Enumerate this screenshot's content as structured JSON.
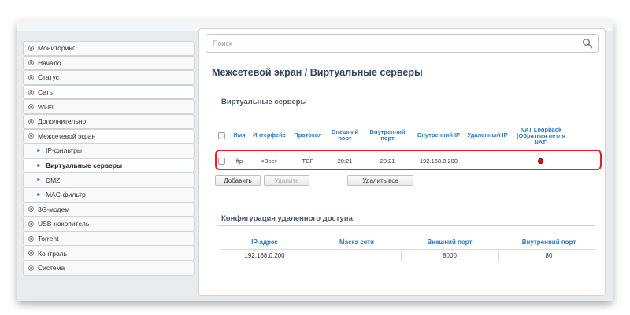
{
  "search": {
    "placeholder": "Поиск"
  },
  "sidebar": {
    "items": [
      {
        "label": "Мониторинг"
      },
      {
        "label": "Начало"
      },
      {
        "label": "Статус"
      },
      {
        "label": "Сеть"
      },
      {
        "label": "Wi-Fi"
      },
      {
        "label": "Дополнительно"
      },
      {
        "label": "Межсетевой экран"
      },
      {
        "label": "IP-фильтры"
      },
      {
        "label": "Виртуальные серверы"
      },
      {
        "label": "DMZ"
      },
      {
        "label": "MAC-фильтр"
      },
      {
        "label": "3G-модем"
      },
      {
        "label": "USB-накопитель"
      },
      {
        "label": "Torrent"
      },
      {
        "label": "Контроль"
      },
      {
        "label": "Система"
      }
    ]
  },
  "main": {
    "title": "Межсетевой экран /  Виртуальные серверы",
    "virtual_servers": {
      "section_title": "Виртуальные серверы",
      "columns": {
        "name": "Имя",
        "interface": "Интерфейс",
        "protocol": "Протокол",
        "ext_port": "Внешний порт",
        "int_port": "Внутренний порт",
        "int_ip": "Внутренний IP",
        "remote_ip": "Удаленный IP",
        "nat_loopback": "NAT Loopback (Обратная петля NAT)"
      },
      "rows": [
        {
          "name": "ftp",
          "interface": "<Все>",
          "protocol": "TCP",
          "ext_port": "20:21",
          "int_port": "20:21",
          "int_ip": "192.168.0.200",
          "remote_ip": "",
          "nat_loopback_enabled": true
        }
      ],
      "buttons": {
        "add": "Добавить",
        "delete": "Удалить",
        "delete_all": "Удалить все"
      }
    },
    "remote_access": {
      "section_title": "Конфигурация удаленного доступа",
      "columns": {
        "ip": "IP-адрес",
        "mask": "Маска сети",
        "ext_port": "Внешний порт",
        "int_port": "Внутренний порт"
      },
      "rows": [
        {
          "ip": "192.168.0.200",
          "mask": "",
          "ext_port": "8000",
          "int_port": "80"
        }
      ]
    }
  },
  "colors": {
    "header_blue": "#2b7bc0",
    "title_dark": "#2f4458",
    "highlight_red": "#d9232e",
    "nat_dot_red": "#d11a1a"
  }
}
